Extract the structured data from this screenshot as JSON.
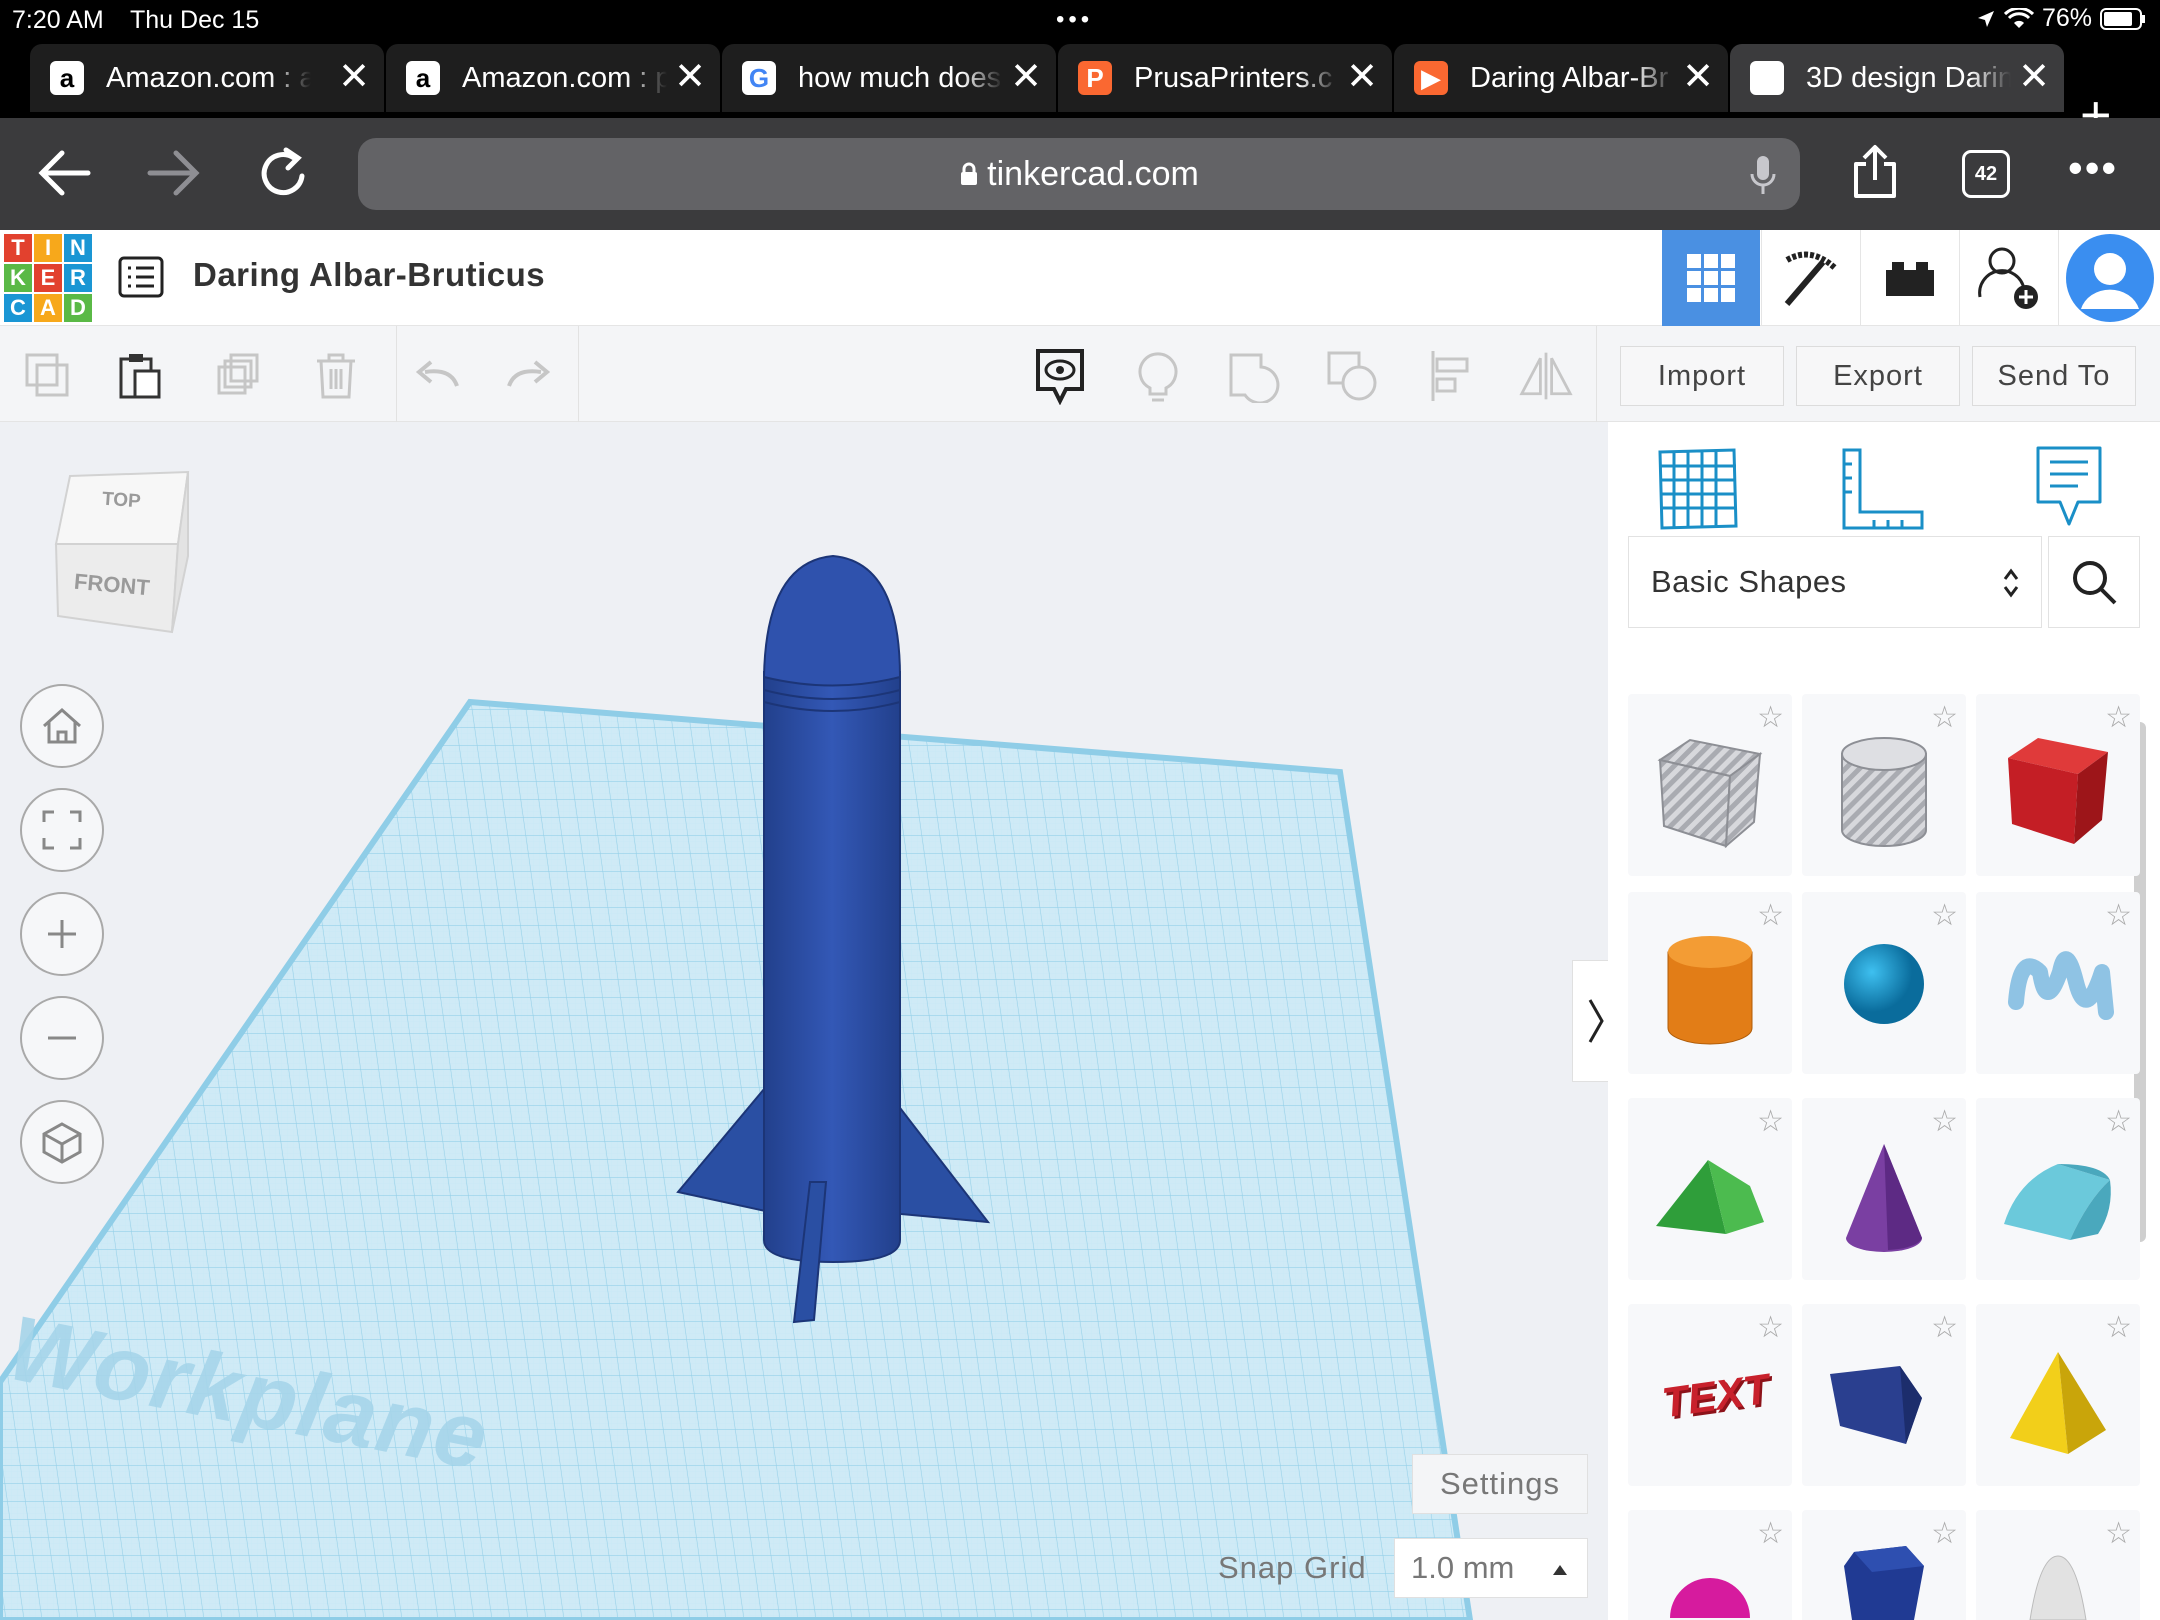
{
  "status_bar": {
    "time": "7:20 AM",
    "date": "Thu Dec 15",
    "battery": "76%"
  },
  "tabs": [
    {
      "title": "Amazon.com : a",
      "favicon": "amazon-icon",
      "active": false
    },
    {
      "title": "Amazon.com : p",
      "favicon": "amazon-icon",
      "active": false
    },
    {
      "title": "how much does",
      "favicon": "google-icon",
      "active": false
    },
    {
      "title": "PrusaPrinters.c",
      "favicon": "prusa-icon",
      "active": false
    },
    {
      "title": "Daring Albar-Br",
      "favicon": "tinkercad-design-icon",
      "active": false
    },
    {
      "title": "3D design Darin",
      "favicon": "tinkercad-icon",
      "active": true
    }
  ],
  "browser": {
    "url": "tinkercad.com",
    "tab_count": "42"
  },
  "header": {
    "project_title": "Daring Albar-Bruticus",
    "logo_letters": [
      "T",
      "I",
      "N",
      "K",
      "E",
      "R",
      "C",
      "A",
      "D"
    ]
  },
  "toolbar": {
    "import_label": "Import",
    "export_label": "Export",
    "send_to_label": "Send To"
  },
  "viewcube": {
    "top": "TOP",
    "front": "FRONT"
  },
  "canvas": {
    "workplane_label": "Workplane",
    "settings_label": "Settings",
    "snap_grid_label": "Snap Grid",
    "snap_grid_value": "1.0 mm"
  },
  "panel": {
    "category": "Basic Shapes",
    "shapes": [
      "Box Hole",
      "Cylinder Hole",
      "Box",
      "Cylinder",
      "Sphere",
      "Scribble",
      "Roof",
      "Cone",
      "Round Roof",
      "Text",
      "Wedge",
      "Pyramid",
      "Half Sphere",
      "Polygon",
      "Paraboloid"
    ],
    "text_shape_label": "TEXT"
  },
  "colors": {
    "accent": "#4a90e2",
    "workplane": "#bfe4f4",
    "rocket": "#2a4fa3",
    "tab_active": "#3b3b3d"
  }
}
